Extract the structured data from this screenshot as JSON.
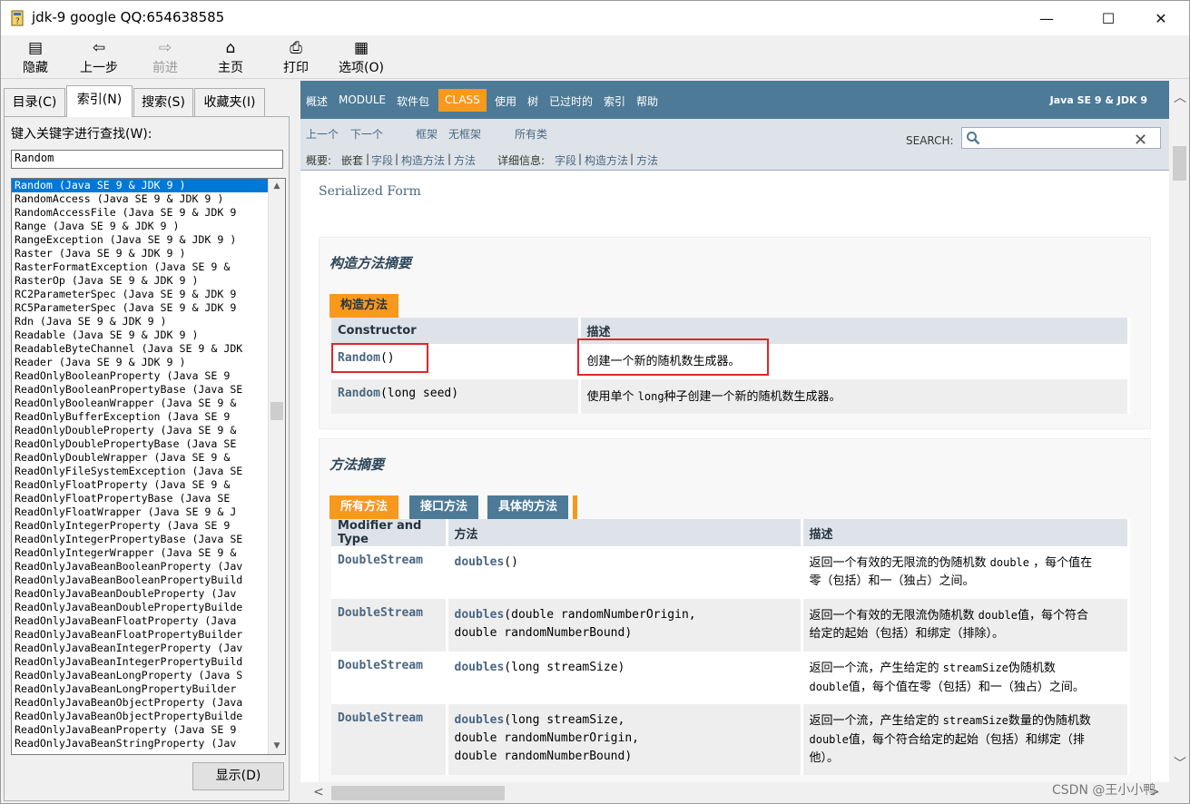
{
  "window": {
    "title": "jdk-9 google QQ:654638585",
    "minimize": "—",
    "maximize": "☐",
    "close": "✕"
  },
  "toolbar": {
    "hide": "隐藏",
    "back": "上一步",
    "forward": "前进",
    "home": "主页",
    "print": "打印",
    "options": "选项(O)"
  },
  "left_tabs": [
    "目录(C)",
    "索引(N)",
    "搜索(S)",
    "收藏夹(I)"
  ],
  "left_tabs_active": "索引(N)",
  "index": {
    "label": "键入关键字进行查找(W):",
    "search_value": "Random",
    "show_button": "显示(D)",
    "items": [
      "Random (Java SE 9 & JDK 9 )",
      "RandomAccess (Java SE 9 & JDK 9 )",
      "RandomAccessFile (Java SE 9 & JDK 9",
      "Range (Java SE 9 & JDK 9 )",
      "RangeException (Java SE 9 & JDK 9 )",
      "Raster (Java SE 9 & JDK 9 )",
      "RasterFormatException (Java SE 9 &",
      "RasterOp (Java SE 9 & JDK 9 )",
      "RC2ParameterSpec (Java SE 9 & JDK 9",
      "RC5ParameterSpec (Java SE 9 & JDK 9",
      "Rdn (Java SE 9 & JDK 9 )",
      "Readable (Java SE 9 & JDK 9 )",
      "ReadableByteChannel (Java SE 9 & JDK",
      "Reader (Java SE 9 & JDK 9 )",
      "ReadOnlyBooleanProperty (Java SE 9",
      "ReadOnlyBooleanPropertyBase (Java SE",
      "ReadOnlyBooleanWrapper (Java SE 9 &",
      "ReadOnlyBufferException (Java SE 9",
      "ReadOnlyDoubleProperty (Java SE 9 &",
      "ReadOnlyDoublePropertyBase (Java SE",
      "ReadOnlyDoubleWrapper (Java SE 9 &",
      "ReadOnlyFileSystemException (Java SE",
      "ReadOnlyFloatProperty (Java SE 9 &",
      "ReadOnlyFloatPropertyBase (Java SE",
      "ReadOnlyFloatWrapper (Java SE 9 & J",
      "ReadOnlyIntegerProperty (Java SE 9",
      "ReadOnlyIntegerPropertyBase (Java SE",
      "ReadOnlyIntegerWrapper (Java SE 9 &",
      "ReadOnlyJavaBeanBooleanProperty (Jav",
      "ReadOnlyJavaBeanBooleanPropertyBuild",
      "ReadOnlyJavaBeanDoubleProperty (Jav",
      "ReadOnlyJavaBeanDoublePropertyBuilde",
      "ReadOnlyJavaBeanFloatProperty (Java",
      "ReadOnlyJavaBeanFloatPropertyBuilder",
      "ReadOnlyJavaBeanIntegerProperty (Jav",
      "ReadOnlyJavaBeanIntegerPropertyBuild",
      "ReadOnlyJavaBeanLongProperty (Java S",
      "ReadOnlyJavaBeanLongPropertyBuilder",
      "ReadOnlyJavaBeanObjectProperty (Java",
      "ReadOnlyJavaBeanObjectPropertyBuilde",
      "ReadOnlyJavaBeanProperty (Java SE 9",
      "ReadOnlyJavaBeanStringProperty (Jav"
    ],
    "selected_index": 0
  },
  "topnav": {
    "items": [
      "概述",
      "MODULE",
      "软件包",
      "CLASS",
      "使用",
      "树",
      "已过时的",
      "索引",
      "帮助"
    ],
    "current": "CLASS",
    "brand": "Java SE 9 & JDK 9"
  },
  "subnav": {
    "prev": "上一个",
    "next": "下一个",
    "frames": "框架",
    "noframes": "无框架",
    "allclasses": "所有类",
    "search_label": "SEARCH:",
    "summary_label": "概要:",
    "summary_nested": "嵌套",
    "summary_field": "字段",
    "summary_constr": "构造方法",
    "summary_method": "方法",
    "detail_label": "详细信息:",
    "detail_field": "字段",
    "detail_constr": "构造方法",
    "detail_method": "方法",
    "sep": "|"
  },
  "content": {
    "serialized_form": "Serialized Form",
    "constructor_summary": {
      "heading": "构造方法摘要",
      "tab": "构造方法",
      "col_constructor": "Constructor",
      "col_desc": "描述",
      "rows": [
        {
          "name": "Random",
          "params": "()",
          "desc": "创建一个新的随机数生成器。"
        },
        {
          "name": "Random",
          "params": "(long seed)",
          "desc_pre": "使用单个 ",
          "desc_code": "long",
          "desc_post": "种子创建一个新的随机数生成器。"
        }
      ]
    },
    "method_summary": {
      "heading": "方法摘要",
      "tabs": [
        "所有方法",
        "接口方法",
        "具体的方法"
      ],
      "col_type": "Modifier and Type",
      "col_method": "方法",
      "col_desc": "描述",
      "rows": [
        {
          "type": "DoubleStream",
          "method": "doubles",
          "params": [
            "()"
          ],
          "desc_lines": [
            [
              "返回一个有效的无限流的伪随机数 ",
              {
                "code": "double"
              },
              " ，每个值在"
            ],
            [
              "零（包括）和一（独占）之间。"
            ]
          ]
        },
        {
          "type": "DoubleStream",
          "method": "doubles",
          "params": [
            "(double randomNumberOrigin,",
            "double randomNumberBound)"
          ],
          "desc_lines": [
            [
              "返回一个有效的无限流伪随机数 ",
              {
                "code": "double"
              },
              "值，每个符合"
            ],
            [
              "给定的起始（包括）和绑定（排除）。"
            ]
          ]
        },
        {
          "type": "DoubleStream",
          "method": "doubles",
          "params": [
            "(long streamSize)"
          ],
          "desc_lines": [
            [
              "返回一个流，产生给定的 ",
              {
                "code": "streamSize"
              },
              "伪随机数"
            ],
            [
              {
                "code": "double"
              },
              "值，每个值在零（包括）和一（独占）之间。"
            ]
          ]
        },
        {
          "type": "DoubleStream",
          "method": "doubles",
          "params": [
            "(long streamSize,",
            "double randomNumberOrigin,",
            "double randomNumberBound)"
          ],
          "desc_lines": [
            [
              "返回一个流，产生给定的 ",
              {
                "code": "streamSize"
              },
              "数量的伪随机数"
            ],
            [
              {
                "code": "double"
              },
              "值，每个符合给定的起始（包括）和绑定（排"
            ],
            [
              "他）。"
            ]
          ]
        }
      ]
    }
  },
  "watermark": "CSDN @王小小鸭"
}
